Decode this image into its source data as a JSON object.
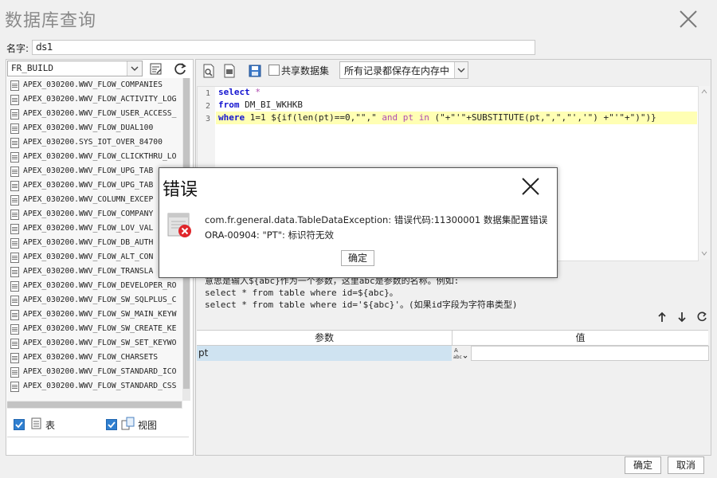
{
  "window": {
    "title": "数据库查询"
  },
  "name_field": {
    "label": "名字:",
    "value": "ds1"
  },
  "left": {
    "connection": "FR_BUILD",
    "tables": [
      "APEX_030200.WWV_FLOW_COMPANIES",
      "APEX_030200.WWV_FLOW_ACTIVITY_LOG",
      "APEX_030200.WWV_FLOW_USER_ACCESS_",
      "APEX_030200.WWV_FLOW_DUAL100",
      "APEX_030200.SYS_IOT_OVER_84700",
      "APEX_030200.WWV_FLOW_CLICKTHRU_LO",
      "APEX_030200.WWV_FLOW_UPG_TAB",
      "APEX_030200.WWV_FLOW_UPG_TAB",
      "APEX_030200.WWV_COLUMN_EXCEP",
      "APEX_030200.WWV_FLOW_COMPANY",
      "APEX_030200.WWV_FLOW_LOV_VAL",
      "APEX_030200.WWV_FLOW_DB_AUTH",
      "APEX_030200.WWV_FLOW_ALT_CON",
      "APEX_030200.WWV_FLOW_TRANSLA",
      "APEX_030200.WWV_FLOW_DEVELOPER_RO",
      "APEX_030200.WWV_FLOW_SW_SQLPLUS_C",
      "APEX_030200.WWV_FLOW_SW_MAIN_KEYW",
      "APEX_030200.WWV_FLOW_SW_CREATE_KE",
      "APEX_030200.WWV_FLOW_SW_SET_KEYWO",
      "APEX_030200.WWV_FLOW_CHARSETS",
      "APEX_030200.WWV_FLOW_STANDARD_ICO",
      "APEX_030200.WWV_FLOW_STANDARD_CSS"
    ],
    "filter_table_label": "表",
    "filter_view_label": "视图"
  },
  "toolbar": {
    "share_label": "共享数据集",
    "cache_option": "所有记录都保存在内存中"
  },
  "editor": {
    "line_numbers": [
      "1",
      "2",
      "3"
    ],
    "line1": {
      "kw": "select",
      "rest": " *"
    },
    "line2": {
      "kw": "from",
      "rest": " DM_BI_WKHKB"
    },
    "line3": {
      "kw": "where",
      "rest1": " 1=1 ${if(len(pt)==0,\"\",\" ",
      "kw2": "and",
      "rest2": " pt ",
      "kw3": "in",
      "rest3": " (\"+\"'\"+SUBSTITUTE(pt,\",\",\"','\") +\"'\"+\")\")}"
    }
  },
  "hints": [
    "意思是输入${abc}作为一个参数，这里abc是参数的名称。例如:",
    "select * from table where id=${abc}。",
    "select * from table where id='${abc}'。(如果id字段为字符串类型)"
  ],
  "params": {
    "col_name": "参数",
    "col_value": "值",
    "rows": [
      {
        "name": "pt",
        "value": ""
      }
    ]
  },
  "buttons": {
    "ok": "确定",
    "cancel": "取消"
  },
  "dialog": {
    "title": "错误",
    "message_line1": "com.fr.general.data.TableDataException: 错误代码:11300001 数据集配置错误",
    "message_line2": "ORA-00904: \"PT\": 标识符无效",
    "ok": "确定"
  }
}
